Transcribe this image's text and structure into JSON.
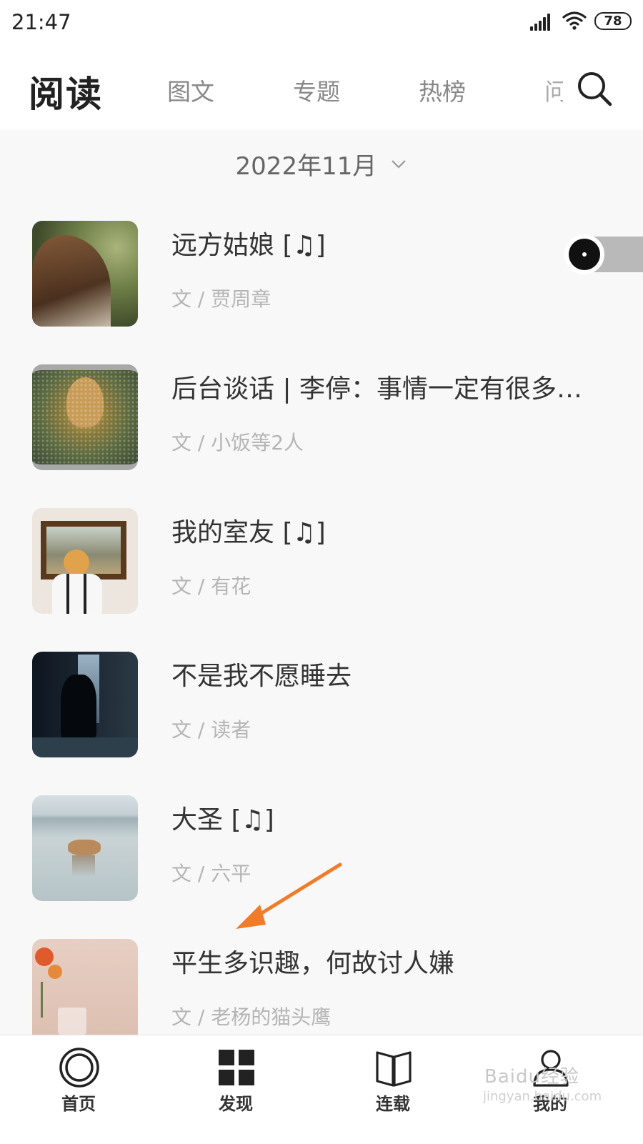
{
  "status_bar": {
    "time": "21:47",
    "battery": "78"
  },
  "header": {
    "title": "阅读",
    "tabs": [
      {
        "label": "图文"
      },
      {
        "label": "专题"
      },
      {
        "label": "热榜"
      },
      {
        "label": "问"
      }
    ]
  },
  "month_picker": {
    "label": "2022年11月"
  },
  "articles": [
    {
      "title": "远方姑娘 [♫]",
      "meta": "文 / 贾周章"
    },
    {
      "title": "后台谈话 | 李停：事情一定有很多…",
      "meta": "文 / 小饭等2人"
    },
    {
      "title": "我的室友 [♫]",
      "meta": "文 / 有花"
    },
    {
      "title": "不是我不愿睡去",
      "meta": "文 / 读者"
    },
    {
      "title": "大圣 [♫]",
      "meta": "文 / 六平"
    },
    {
      "title": "平生多识趣，何故讨人嫌",
      "meta": "文 / 老杨的猫头鹰"
    }
  ],
  "bottom_nav": [
    {
      "label": "首页",
      "icon": "home-ring-icon"
    },
    {
      "label": "发现",
      "icon": "grid-icon"
    },
    {
      "label": "连载",
      "icon": "book-icon"
    },
    {
      "label": "我的",
      "icon": "user-icon"
    }
  ],
  "watermark": {
    "text": "Baidu经验",
    "sub": "jingyan.baidu.com"
  },
  "colors": {
    "annotation_arrow": "#f07c2a",
    "background": "#f8f8f8"
  }
}
